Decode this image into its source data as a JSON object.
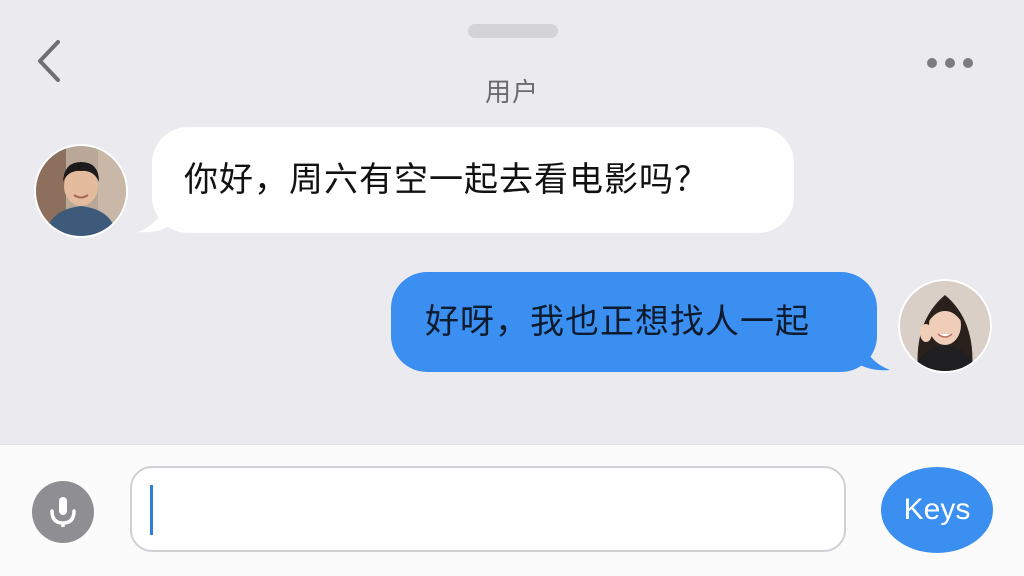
{
  "header": {
    "title": "用户",
    "back_icon": "chevron-left-icon",
    "more_icon": "ellipsis-icon"
  },
  "messages": [
    {
      "direction": "incoming",
      "text": "你好，周六有空一起去看电影吗？",
      "avatar": "male-avatar"
    },
    {
      "direction": "outgoing",
      "text": "好呀，我也正想找人一起",
      "avatar": "female-avatar"
    }
  ],
  "composer": {
    "value": "",
    "placeholder": "",
    "mic_icon": "microphone-icon",
    "keys_label": "Keys"
  },
  "colors": {
    "background": "#ebebef",
    "incoming_bubble": "#ffffff",
    "outgoing_bubble": "#3b8ff0",
    "accent": "#3b8ff0",
    "composer_bar": "#fbfbfc"
  }
}
